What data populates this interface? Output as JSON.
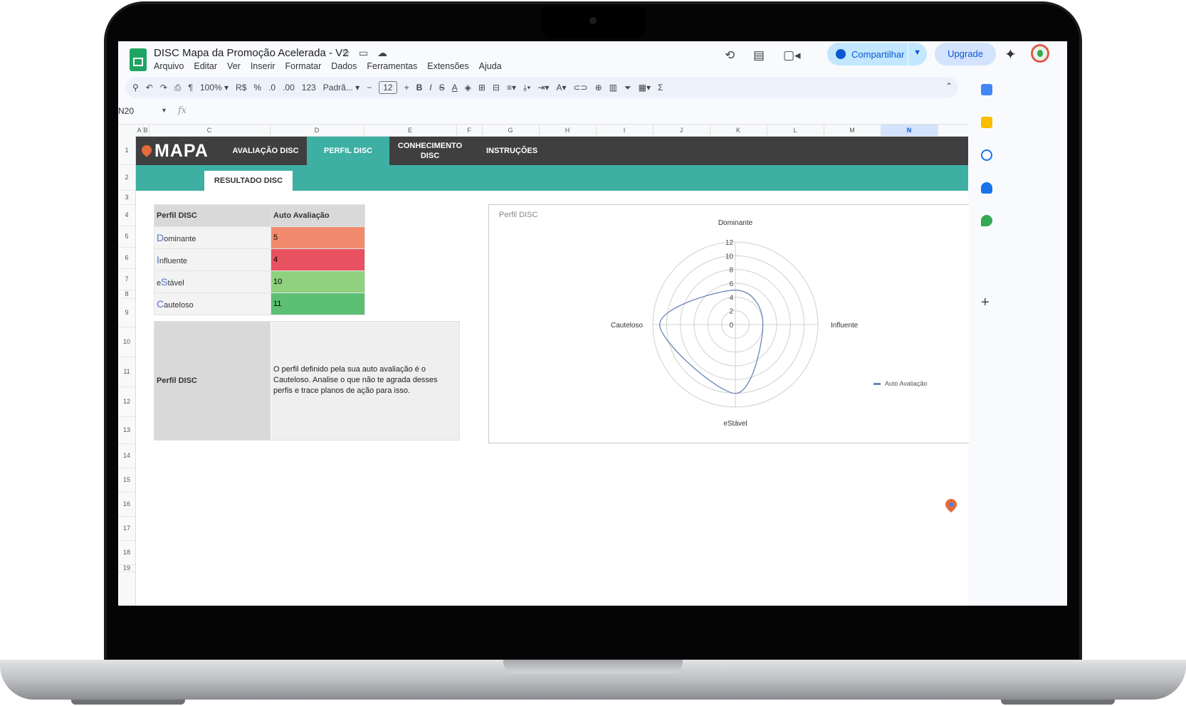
{
  "doc": {
    "title": "DISC Mapa da Promoção Acelerada - V2",
    "menu": [
      "Arquivo",
      "Editar",
      "Ver",
      "Inserir",
      "Formatar",
      "Dados",
      "Ferramentas",
      "Extensões",
      "Ajuda"
    ],
    "share_label": "Compartilhar",
    "upgrade_label": "Upgrade"
  },
  "toolbar": {
    "zoom": "100%",
    "currency": "R$",
    "percent": "%",
    "dec_less": ".0",
    "dec_more": ".00",
    "format_num": "123",
    "font": "Padrã...",
    "font_size": "12"
  },
  "formula_bar": {
    "name_box": "N20",
    "fx": "fx"
  },
  "columns": [
    "A",
    "B",
    "C",
    "D",
    "E",
    "F",
    "G",
    "H",
    "I",
    "J",
    "K",
    "L",
    "M",
    "N"
  ],
  "selected_column": "N",
  "rows": [
    "1",
    "2",
    "3",
    "4",
    "5",
    "6",
    "7",
    "8",
    "9",
    "10",
    "11",
    "12",
    "13",
    "14",
    "15",
    "16",
    "17",
    "18",
    "19"
  ],
  "nav": {
    "brand": "MAPA",
    "tabs": [
      "AVALIAÇÃO DISC",
      "PERFIL DISC",
      "CONHECIMENTO DISC",
      "INSTRUÇÕES"
    ],
    "active_tab": "PERFIL DISC",
    "subtab": "RESULTADO DISC"
  },
  "table": {
    "header": [
      "Perfil DISC",
      "Auto Avaliação"
    ],
    "rows": [
      {
        "cap": "D",
        "rest": "ominante",
        "value": "5",
        "color": "#f28b6e"
      },
      {
        "cap": "I",
        "rest": "nfluente",
        "value": "4",
        "color": "#e8515f"
      },
      {
        "pre": "e",
        "cap": "S",
        "rest": "tável",
        "value": "10",
        "color": "#8fd17e"
      },
      {
        "cap": "C",
        "rest": "auteloso",
        "value": "11",
        "color": "#5cbf73"
      }
    ]
  },
  "summary": {
    "label": "Perfil DISC",
    "text": "O perfil definido pela sua auto avaliação é o Cauteloso. Analise o que não te agrada desses perfis e trace planos de ação para isso."
  },
  "chart_data": {
    "type": "radar",
    "title": "Perfil DISC",
    "categories": [
      "Dominante",
      "Influente",
      "eStável",
      "Cauteloso"
    ],
    "series": [
      {
        "name": "Auto Avaliação",
        "values": [
          5,
          4,
          10,
          11
        ],
        "color": "#6a86b8"
      }
    ],
    "rlim": [
      0,
      12
    ],
    "ticks": [
      "0",
      "2",
      "4",
      "6",
      "8",
      "10",
      "12"
    ],
    "legend": "right"
  }
}
